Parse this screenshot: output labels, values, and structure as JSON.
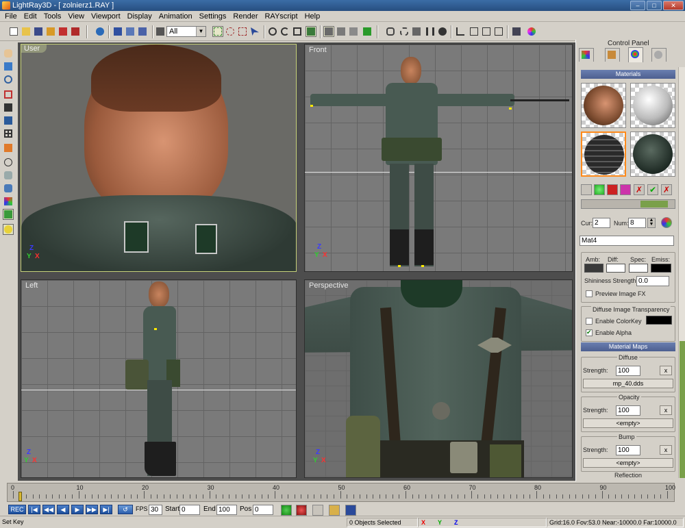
{
  "window": {
    "title": "LightRay3D - [ zolnierz1.RAY ]"
  },
  "menu": [
    "File",
    "Edit",
    "Tools",
    "View",
    "Viewport",
    "Display",
    "Animation",
    "Settings",
    "Render",
    "RAYscript",
    "Help"
  ],
  "toolbar": {
    "selection_filter": "All"
  },
  "viewports": {
    "top_left": "User",
    "top_right": "Front",
    "bottom_left": "Left",
    "bottom_right": "Perspective"
  },
  "axes": {
    "x": "X",
    "y": "Y",
    "z": "Z"
  },
  "control_panel": {
    "title": "Control Panel",
    "materials_header": "Materials",
    "cur_label": "Cur:",
    "cur_value": "2",
    "num_label": "Num:",
    "num_value": "8",
    "material_name": "Mat4",
    "amb_label": "Amb:",
    "diff_label": "Diff:",
    "spec_label": "Spec:",
    "emiss_label": "Emiss:",
    "shininess_label": "Shininess Strength:",
    "shininess_value": "0.0",
    "preview_fx_label": "Preview Image FX",
    "transparency_legend": "Diffuse Image Transparency",
    "colorkey_label": "Enable ColorKey",
    "alpha_label": "Enable Alpha",
    "maps_header": "Material Maps",
    "diffuse": {
      "title": "Diffuse",
      "strength_label": "Strength:",
      "strength": "100",
      "file": "mp_40.dds"
    },
    "opacity": {
      "title": "Opacity",
      "strength_label": "Strength:",
      "strength": "100",
      "file": "<empty>"
    },
    "bump": {
      "title": "Bump",
      "strength_label": "Strength:",
      "strength": "100",
      "file": "<empty>"
    },
    "reflection": {
      "title": "Reflection"
    },
    "x_label": "x"
  },
  "timeline": {
    "labels": [
      "0",
      "10",
      "20",
      "30",
      "40",
      "50",
      "60",
      "70",
      "80",
      "90",
      "100"
    ]
  },
  "playback": {
    "rec": "REC",
    "fps_label": "FPS",
    "fps": "30",
    "start_label": "Start",
    "start": "0",
    "end_label": "End",
    "end": "100",
    "pos_label": "Pos",
    "pos": "0"
  },
  "status": {
    "left": "Set Key",
    "objects": "0 Objects Selected",
    "x": "X",
    "y": "Y",
    "z": "Z",
    "camera": "Grid:16.0 Fov:53.0 Near:-10000.0 Far:10000.0"
  },
  "colors": {
    "accent": "#4d5f90",
    "selection": "#ff8a1a",
    "viewport_bg": "#7a7a7a"
  }
}
